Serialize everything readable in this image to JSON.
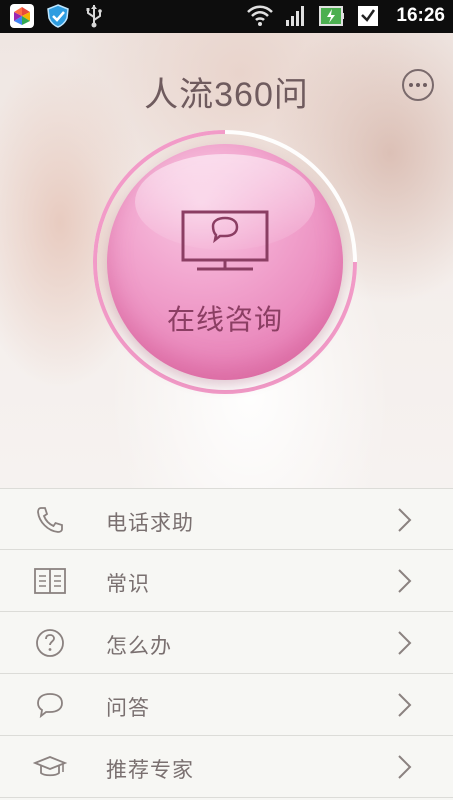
{
  "status_bar": {
    "time": "16:26",
    "icons": [
      "app-notification-icon",
      "shield-icon",
      "usb-icon",
      "wifi-icon",
      "signal-icon",
      "battery-charging-icon",
      "download-complete-icon"
    ]
  },
  "header": {
    "title": "人流360问",
    "more_icon": "more-dots-icon"
  },
  "hero": {
    "consult_label": "在线咨询",
    "consult_icon": "monitor-chat-icon",
    "accent_color": "#f29bc8"
  },
  "menu": {
    "items": [
      {
        "label": "电话求助",
        "icon": "phone-icon"
      },
      {
        "label": "常识",
        "icon": "book-icon"
      },
      {
        "label": "怎么办",
        "icon": "question-icon"
      },
      {
        "label": "问答",
        "icon": "speech-bubble-icon"
      },
      {
        "label": "推荐专家",
        "icon": "graduation-cap-icon"
      }
    ],
    "chevron_icon": "chevron-right-icon"
  }
}
